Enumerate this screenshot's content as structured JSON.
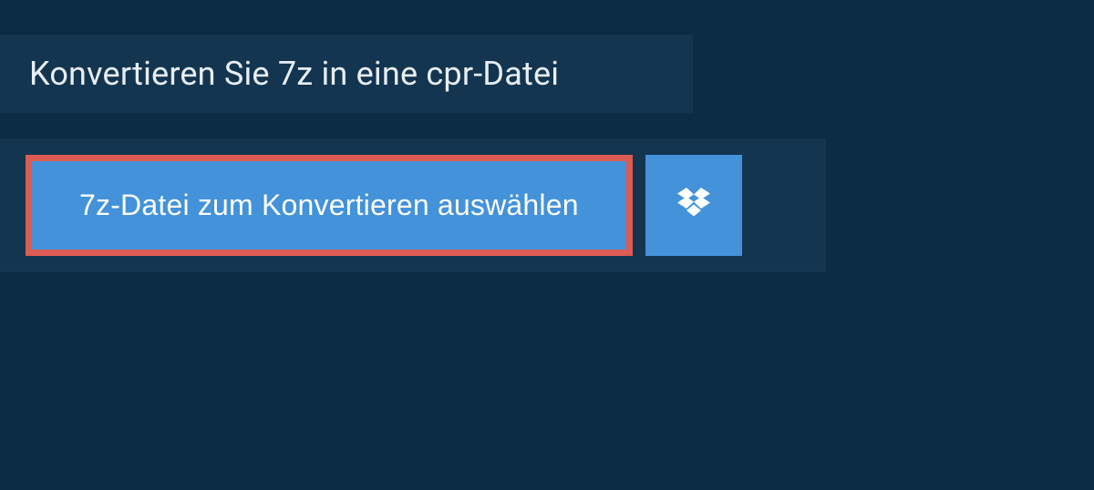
{
  "header": {
    "title": "Konvertieren Sie 7z in eine cpr-Datei"
  },
  "upload": {
    "select_label": "7z-Datei zum Konvertieren auswählen",
    "dropbox_icon": "dropbox-icon"
  },
  "colors": {
    "background": "#0c2b44",
    "panel": "#133550",
    "button": "#4392da",
    "highlight_border": "#dc5c53",
    "text": "#e8eef4"
  }
}
